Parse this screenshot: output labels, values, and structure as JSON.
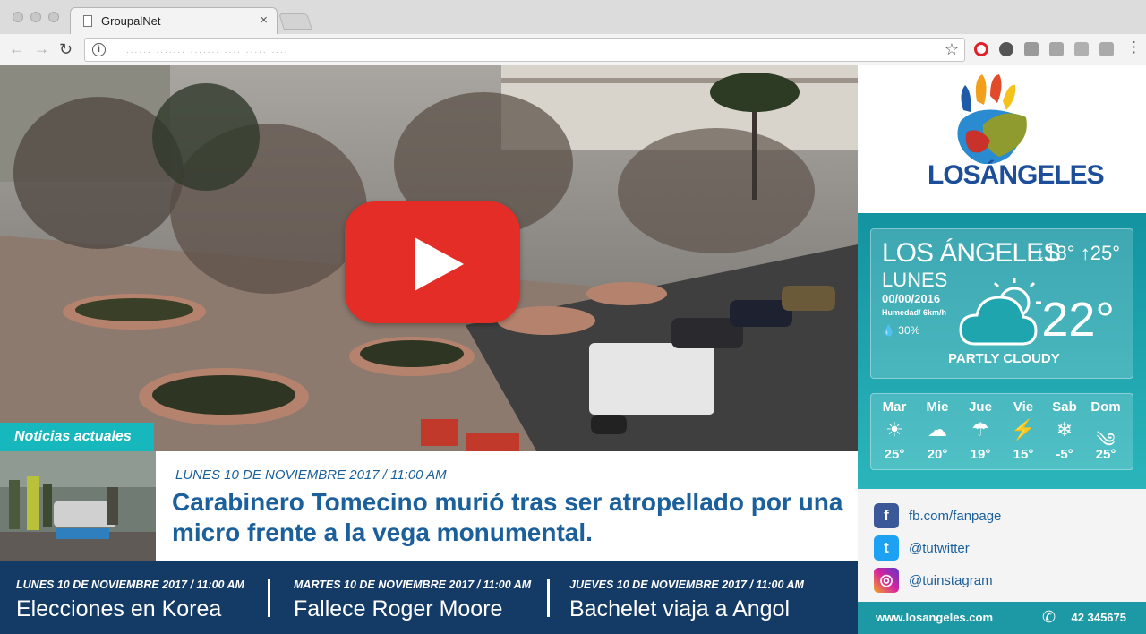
{
  "browser": {
    "tab_title": "GroupalNet",
    "tab_close": "×",
    "url": "...... ....... ....... .... ..... ...."
  },
  "news": {
    "section_label": "Noticias actuales",
    "featured": {
      "date": "LUNES 10 DE NOVIEMBRE 2017 / 11:00 AM",
      "title": "Carabinero Tomecino murió tras ser atropellado por una micro frente a la vega monumental."
    },
    "ticker": [
      {
        "date": "LUNES 10 DE NOVIEMBRE 2017 / 11:00 AM",
        "title": "Elecciones en Korea"
      },
      {
        "date": "MARTES 10 DE NOVIEMBRE 2017 / 11:00 AM",
        "title": "Fallece Roger Moore"
      },
      {
        "date": "JUEVES 10 DE NOVIEMBRE 2017 / 11:00 AM",
        "title": "Bachelet viaja a Angol"
      }
    ]
  },
  "brand": {
    "logo_text": "LOSÁNGELES"
  },
  "weather": {
    "city": "LOS ÁNGELES",
    "day": "LUNES",
    "date": "00/00/2016",
    "humidity": "Humedad/ 6km/h",
    "rain": "30%",
    "low": "↓18°",
    "high": "↑25°",
    "current": "22°",
    "condition": "PARTLY CLOUDY",
    "forecast": [
      {
        "day": "Mar",
        "icon": "sun-icon",
        "temp": "25°"
      },
      {
        "day": "Mie",
        "icon": "cloud-icon",
        "temp": "20°"
      },
      {
        "day": "Jue",
        "icon": "rain-icon",
        "temp": "19°"
      },
      {
        "day": "Vie",
        "icon": "thunder-icon",
        "temp": "15°"
      },
      {
        "day": "Sab",
        "icon": "snow-icon",
        "temp": "-5°"
      },
      {
        "day": "Dom",
        "icon": "wind-icon",
        "temp": "25°"
      }
    ]
  },
  "social": {
    "facebook": "fb.com/fanpage",
    "twitter": "@tutwitter",
    "instagram": "@tuinstagram"
  },
  "footer": {
    "website": "www.losangeles.com",
    "phone": "42 345675"
  },
  "colors": {
    "accent": "#17b8bd",
    "ticker_bg": "#143a66",
    "headline": "#1b5f9b",
    "youtube": "#e52d27"
  }
}
